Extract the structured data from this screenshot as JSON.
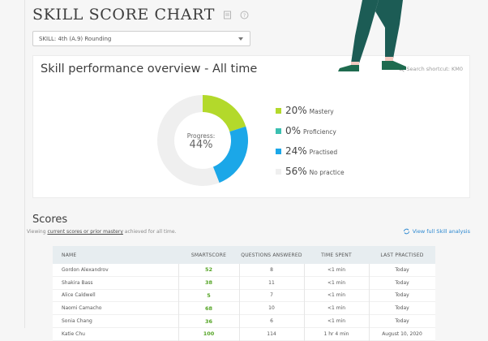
{
  "page": {
    "title": "SKILL SCORE CHART",
    "icons": [
      "print-icon",
      "help-icon"
    ]
  },
  "skill_select": {
    "value": "SKILL: 4th (A.9)  Rounding"
  },
  "overview": {
    "title": "Skill performance overview - All time",
    "shortcut": "Search shortcut: KM0",
    "progress_label": "Progress:",
    "progress_value": "44%",
    "legend": [
      {
        "pct": "20%",
        "label": "Mastery",
        "color": "#b3d92b"
      },
      {
        "pct": "0%",
        "label": "Proficiency",
        "color": "#3bbfb0"
      },
      {
        "pct": "24%",
        "label": "Practised",
        "color": "#1ba7e8"
      },
      {
        "pct": "56%",
        "label": "No practice",
        "color": "#efefef"
      }
    ]
  },
  "chart_data": {
    "type": "pie",
    "categories": [
      "Mastery",
      "Proficiency",
      "Practised",
      "No practice"
    ],
    "values": [
      20,
      0,
      24,
      56
    ],
    "colors": [
      "#b3d92b",
      "#3bbfb0",
      "#1ba7e8",
      "#efefef"
    ]
  },
  "scores": {
    "title": "Scores",
    "viewing_prefix": "Viewing ",
    "viewing_link": "current scores or prior mastery",
    "viewing_suffix": " achieved for all time.",
    "analysis_link": "View full Skill analysis",
    "columns": [
      "NAME",
      "SMARTSCORE",
      "QUESTIONS ANSWERED",
      "TIME SPENT",
      "LAST PRACTISED"
    ],
    "rows": [
      {
        "name": "Gordon Alexandrov",
        "score": "52",
        "questions": "8",
        "time": "<1 min",
        "last": "Today"
      },
      {
        "name": "Shakira Bass",
        "score": "38",
        "questions": "11",
        "time": "<1 min",
        "last": "Today"
      },
      {
        "name": "Alice Caldwell",
        "score": "5",
        "questions": "7",
        "time": "<1 min",
        "last": "Today"
      },
      {
        "name": "Naomi Camacho",
        "score": "68",
        "questions": "10",
        "time": "<1 min",
        "last": "Today"
      },
      {
        "name": "Sonia Chang",
        "score": "36",
        "questions": "6",
        "time": "<1 min",
        "last": "Today"
      },
      {
        "name": "Katie Chu",
        "score": "100",
        "questions": "114",
        "time": "1 hr 4 min",
        "last": "August 10, 2020"
      }
    ]
  }
}
